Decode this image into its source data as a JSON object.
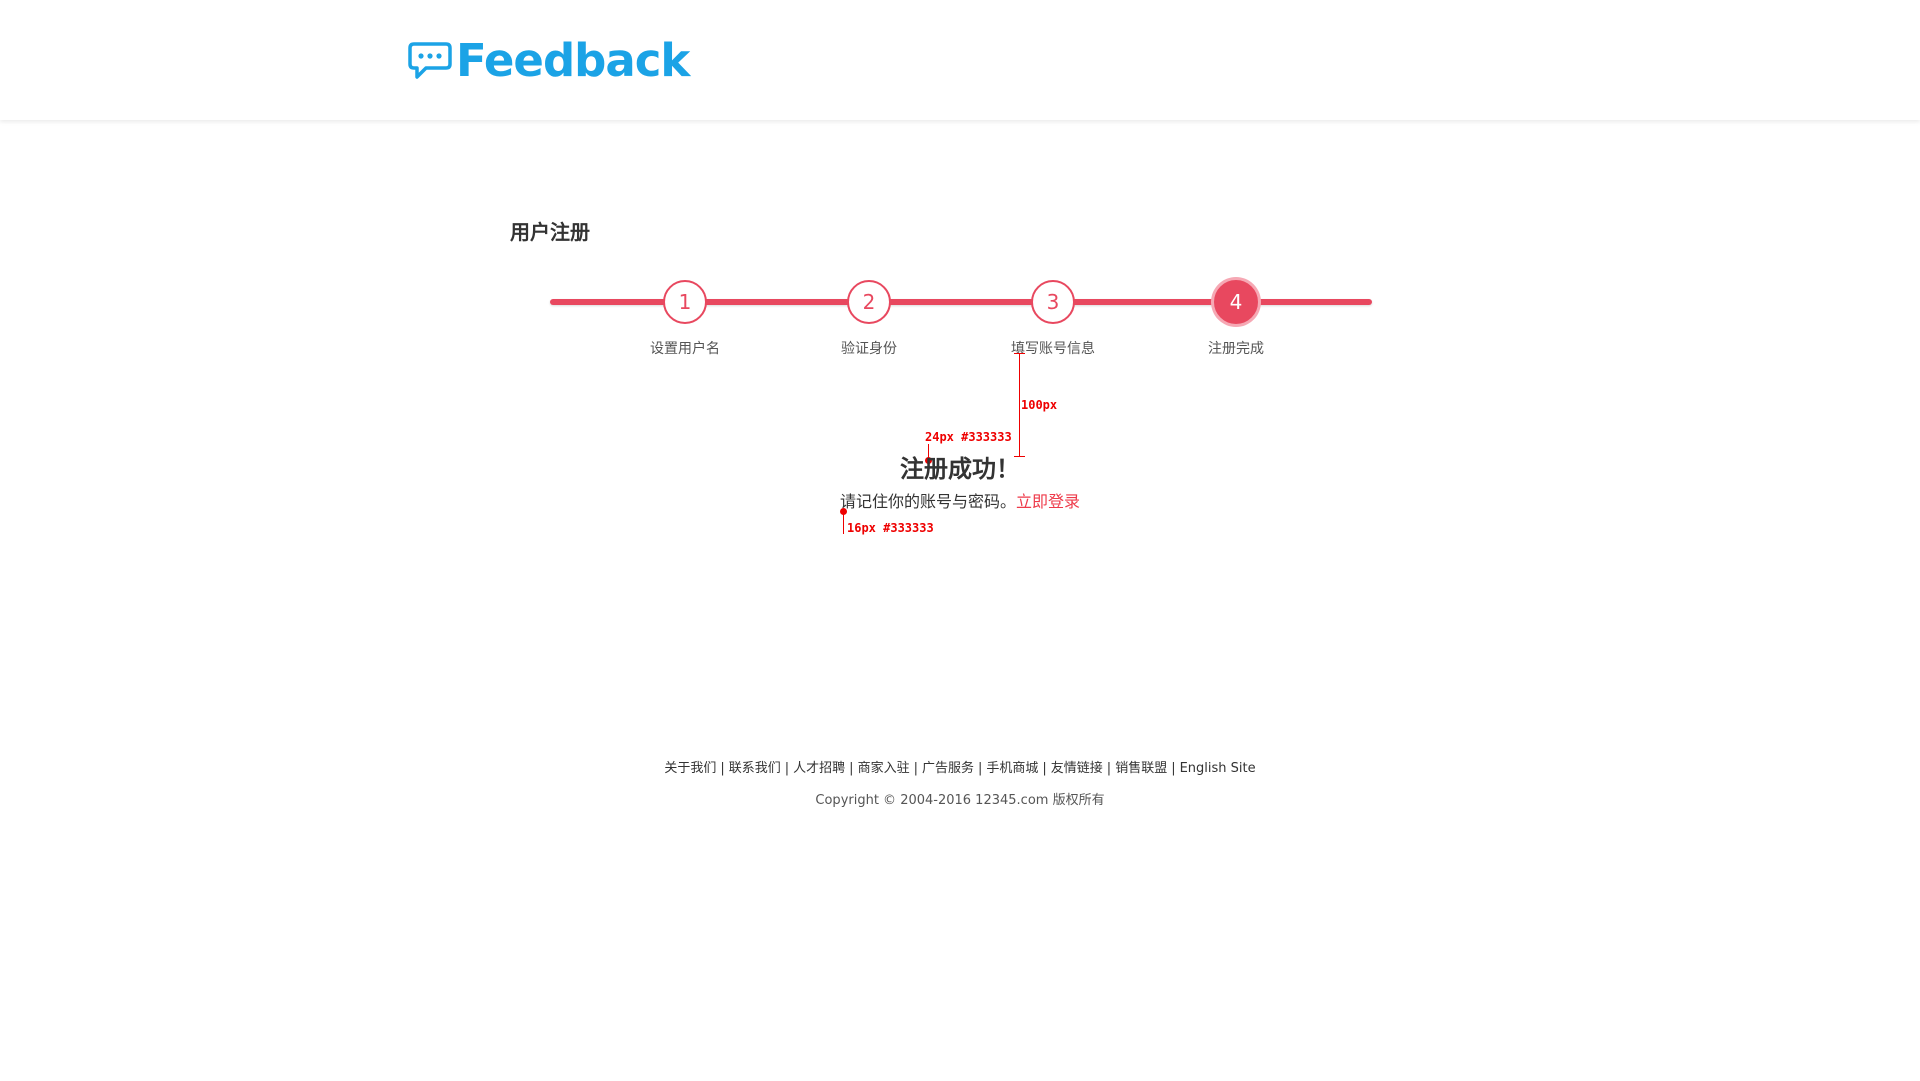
{
  "header": {
    "logo_text": "Feedback",
    "logo_icon": "speech-bubble-icon",
    "brand_color": "#1ba3e6"
  },
  "page_title": "用户注册",
  "steps": {
    "accent_color": "#e8485f",
    "current_step": 4,
    "items": [
      {
        "number": "1",
        "label": "设置用户名"
      },
      {
        "number": "2",
        "label": "验证身份"
      },
      {
        "number": "3",
        "label": "填写账号信息"
      },
      {
        "number": "4",
        "label": "注册完成"
      }
    ]
  },
  "success": {
    "title": "注册成功！",
    "tip": "请记住你的账号与密码。",
    "login_link": "立即登录",
    "link_color": "#ee3a4a"
  },
  "annotations": {
    "spacing": "100px",
    "title_spec": "24px #333333",
    "tip_spec": "16px #333333",
    "color": "#ee0000"
  },
  "footer": {
    "links": [
      "关于我们",
      "联系我们",
      "人才招聘",
      "商家入驻",
      "广告服务",
      "手机商城",
      "友情链接",
      "销售联盟",
      "English Site"
    ],
    "separator": "|",
    "copyright": "Copyright © 2004-2016  12345.com 版权所有"
  }
}
